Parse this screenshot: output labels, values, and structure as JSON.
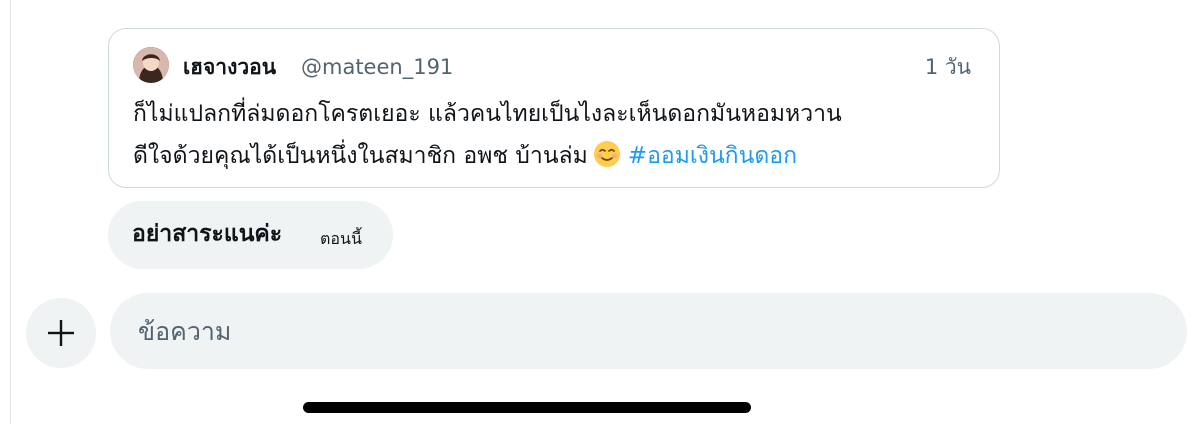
{
  "quoted_tweet": {
    "display_name": "เฮจางวอน",
    "handle": "@mateen_191",
    "time": "1 วัน",
    "text_line1": "ก็ไม่แปลกที่ล่มดอกโครตเยอะ แล้วคนไทยเป็นไงละเห็นดอกมันหอมหวาน",
    "text_line2": "ดีใจด้วยคุณได้เป็นหนึ่งในสมาชิก อพช บ้านล่ม",
    "emoji": "smiling-face-emoji",
    "hashtag": "#ออมเงินกินดอก",
    "hashtag_color": "#1d9bf0"
  },
  "message": {
    "text": "อย่าสาระแนค่ะ",
    "time": "ตอนนี้"
  },
  "composer": {
    "placeholder": "ข้อความ",
    "value": "",
    "add_icon": "plus-icon"
  }
}
